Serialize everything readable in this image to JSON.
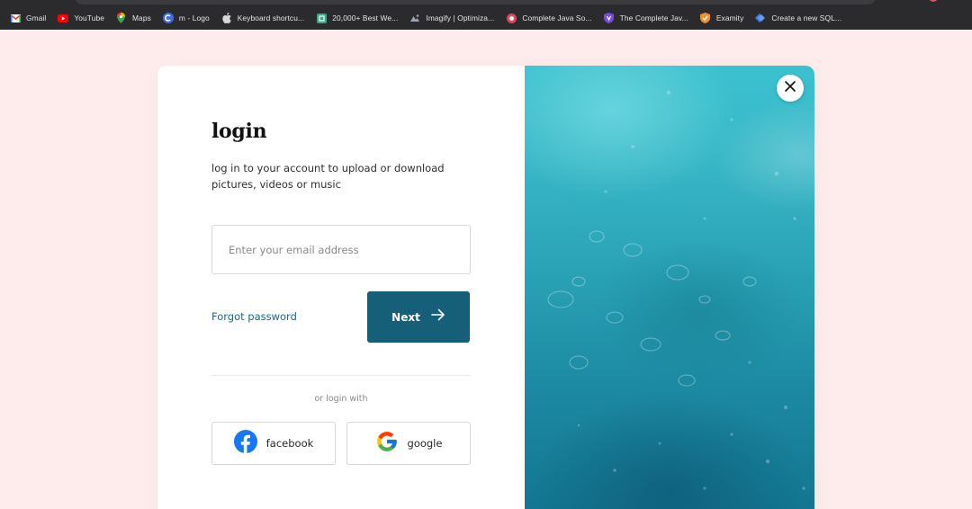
{
  "bookmarks": [
    {
      "label": "Gmail",
      "icon": "gmail-icon"
    },
    {
      "label": "YouTube",
      "icon": "youtube-icon"
    },
    {
      "label": "Maps",
      "icon": "maps-icon"
    },
    {
      "label": "m - Logo",
      "icon": "logo-site-icon"
    },
    {
      "label": "Keyboard shortcu...",
      "icon": "apple-icon"
    },
    {
      "label": "20,000+ Best We...",
      "icon": "web-icon"
    },
    {
      "label": "Imagify | Optimiza...",
      "icon": "imagify-icon"
    },
    {
      "label": "Complete Java So...",
      "icon": "java-course-icon"
    },
    {
      "label": "The Complete Jav...",
      "icon": "shield-course-icon"
    },
    {
      "label": "Examity",
      "icon": "examity-icon"
    },
    {
      "label": "Create a new SQL...",
      "icon": "sql-icon"
    }
  ],
  "login": {
    "title": "login",
    "subtitle": "log in to your account to upload or download pictures, videos or music",
    "email_placeholder": "Enter your email address",
    "email_value": "",
    "forgot_label": "Forgot password",
    "next_label": "Next",
    "or_label": "or login with",
    "facebook_label": "facebook",
    "google_label": "google"
  },
  "colors": {
    "background": "#fdeceb",
    "accent": "#155f78",
    "link": "#1c6b80",
    "facebook": "#1877f2"
  }
}
